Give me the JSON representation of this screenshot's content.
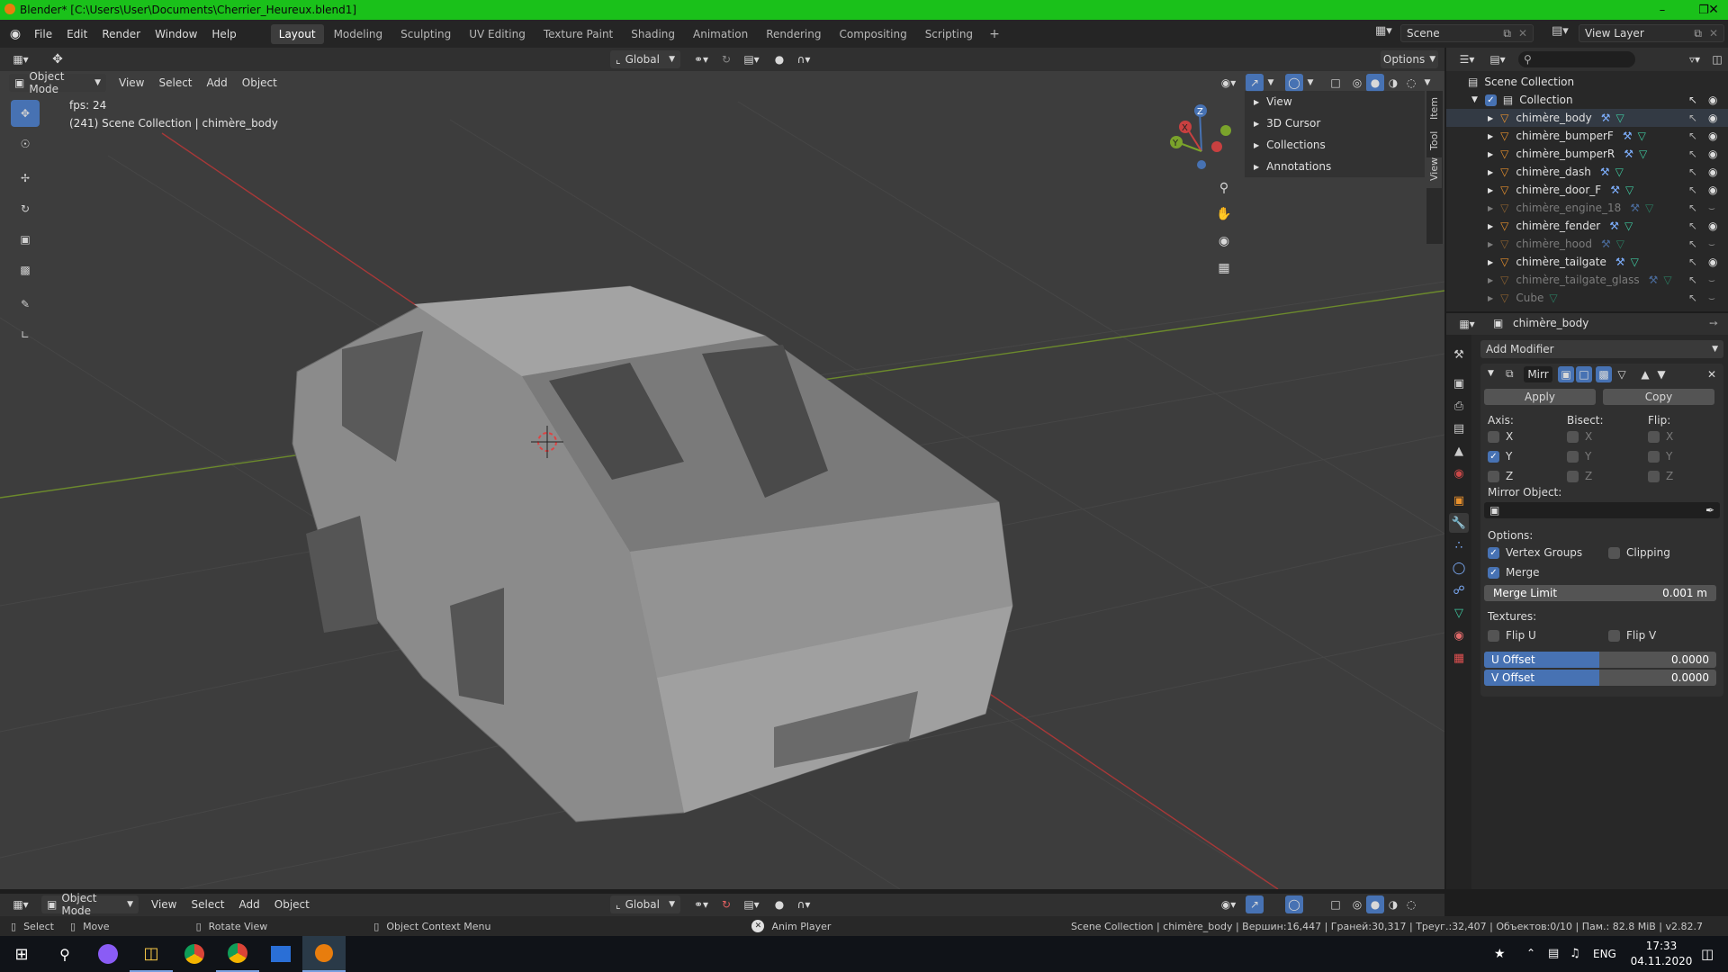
{
  "title_bar": {
    "text": "Blender* [C:\\Users\\User\\Documents\\Cherrier_Heureux.blend1]"
  },
  "top_menu": {
    "items": [
      "File",
      "Edit",
      "Render",
      "Window",
      "Help"
    ],
    "workspaces": [
      "Layout",
      "Modeling",
      "Sculpting",
      "UV Editing",
      "Texture Paint",
      "Shading",
      "Animation",
      "Rendering",
      "Compositing",
      "Scripting"
    ],
    "active_workspace": "Layout",
    "add_tab": "+",
    "scene": "Scene",
    "view_layer": "View Layer"
  },
  "viewport_header": {
    "orientation": "Global",
    "options": "Options",
    "mode": "Object Mode",
    "menus": [
      "View",
      "Select",
      "Add",
      "Object"
    ]
  },
  "viewport": {
    "fps": "fps: 24",
    "info": "(241) Scene Collection | chimère_body",
    "n_panel": [
      "View",
      "3D Cursor",
      "Collections",
      "Annotations"
    ],
    "side_tabs": [
      "Item",
      "Tool",
      "View"
    ]
  },
  "outliner": {
    "scene_collection": "Scene Collection",
    "collection": "Collection",
    "objects": [
      {
        "name": "chimère_body",
        "hidden": false
      },
      {
        "name": "chimère_bumperF",
        "hidden": false
      },
      {
        "name": "chimère_bumperR",
        "hidden": false
      },
      {
        "name": "chimère_dash",
        "hidden": false
      },
      {
        "name": "chimère_door_F",
        "hidden": false
      },
      {
        "name": "chimère_engine_18",
        "hidden": true
      },
      {
        "name": "chimère_fender",
        "hidden": false
      },
      {
        "name": "chimère_hood",
        "hidden": true
      },
      {
        "name": "chimère_tailgate",
        "hidden": false
      },
      {
        "name": "chimère_tailgate_glass",
        "hidden": true
      },
      {
        "name": "Cube",
        "hidden": true
      }
    ]
  },
  "properties": {
    "object_name": "chimère_body",
    "add_modifier": "Add Modifier",
    "modifier_name": "Mirr",
    "apply": "Apply",
    "copy": "Copy",
    "axis_label": "Axis:",
    "bisect_label": "Bisect:",
    "flip_label": "Flip:",
    "axes": [
      {
        "name": "X",
        "axis": false,
        "bisect": false,
        "flip": false
      },
      {
        "name": "Y",
        "axis": true,
        "bisect": false,
        "flip": false
      },
      {
        "name": "Z",
        "axis": false,
        "bisect": false,
        "flip": false
      }
    ],
    "mirror_object_label": "Mirror Object:",
    "options_label": "Options:",
    "vertex_groups": "Vertex Groups",
    "clipping": "Clipping",
    "merge": "Merge",
    "merge_limit_label": "Merge Limit",
    "merge_limit_value": "0.001 m",
    "textures_label": "Textures:",
    "flip_u": "Flip U",
    "flip_v": "Flip V",
    "u_offset_label": "U Offset",
    "u_offset_value": "0.0000",
    "v_offset_label": "V Offset",
    "v_offset_value": "0.0000"
  },
  "bottom_header": {
    "mode": "Object Mode",
    "menus": [
      "View",
      "Select",
      "Add",
      "Object"
    ],
    "orientation": "Global"
  },
  "status_bar": {
    "select": "Select",
    "move": "Move",
    "rotate_view": "Rotate View",
    "context_menu": "Object Context Menu",
    "anim_player": "Anim Player",
    "stats": "Scene Collection | chimère_body | Вершин:16,447 | Граней:30,317 | Треуг.:32,407 | Объектов:0/10 | Пам.: 82.8 MiB | v2.82.7"
  },
  "taskbar": {
    "lang": "ENG",
    "time": "17:33",
    "date": "04.11.2020"
  },
  "colors": {
    "accent": "#4772b3",
    "title_bar": "#1ac11a",
    "viewport_bg": "#3d3d3d"
  }
}
